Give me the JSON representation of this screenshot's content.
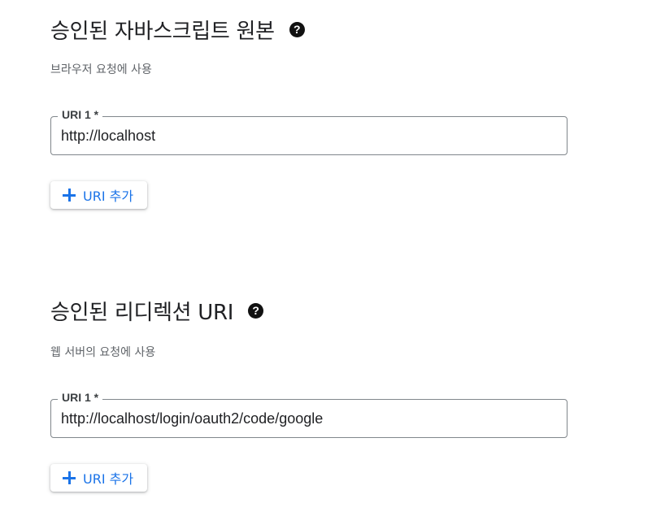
{
  "js_origins": {
    "title": "승인된 자바스크립트 원본",
    "subtitle": "브라우저 요청에 사용",
    "uri_label": "URI 1 *",
    "uri_value": "http://localhost",
    "add_button_label": "URI 추가"
  },
  "redirect_uris": {
    "title": "승인된 리디렉션 URI",
    "subtitle": "웹 서버의 요청에 사용",
    "uri_label": "URI 1 *",
    "uri_value": "http://localhost/login/oauth2/code/google",
    "add_button_label": "URI 추가"
  },
  "icons": {
    "help": "question-mark-circle-icon",
    "add": "plus-icon"
  },
  "colors": {
    "accent": "#1a73e8",
    "text_primary": "#202124",
    "text_secondary": "#5f6368",
    "field_border": "#80868b"
  }
}
